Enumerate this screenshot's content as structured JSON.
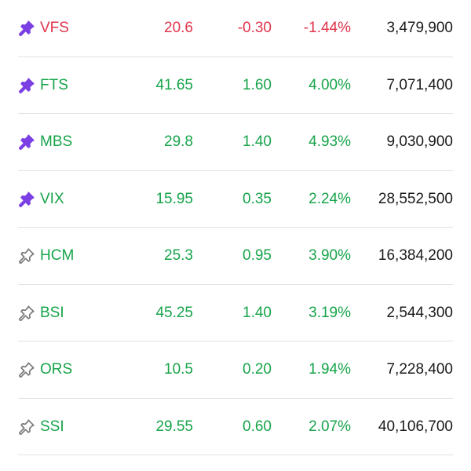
{
  "colors": {
    "up": "#17a44a",
    "down": "#e0344b",
    "pin_active": "#7b3fe4",
    "pin_inactive": "#777777"
  },
  "watchlist": [
    {
      "symbol": "VFS",
      "price": "20.6",
      "change": "-0.30",
      "pct": "-1.44%",
      "volume": "3,479,900",
      "trend": "down",
      "pinned": true
    },
    {
      "symbol": "FTS",
      "price": "41.65",
      "change": "1.60",
      "pct": "4.00%",
      "volume": "7,071,400",
      "trend": "up",
      "pinned": true
    },
    {
      "symbol": "MBS",
      "price": "29.8",
      "change": "1.40",
      "pct": "4.93%",
      "volume": "9,030,900",
      "trend": "up",
      "pinned": true
    },
    {
      "symbol": "VIX",
      "price": "15.95",
      "change": "0.35",
      "pct": "2.24%",
      "volume": "28,552,500",
      "trend": "up",
      "pinned": true
    },
    {
      "symbol": "HCM",
      "price": "25.3",
      "change": "0.95",
      "pct": "3.90%",
      "volume": "16,384,200",
      "trend": "up",
      "pinned": false
    },
    {
      "symbol": "BSI",
      "price": "45.25",
      "change": "1.40",
      "pct": "3.19%",
      "volume": "2,544,300",
      "trend": "up",
      "pinned": false
    },
    {
      "symbol": "ORS",
      "price": "10.5",
      "change": "0.20",
      "pct": "1.94%",
      "volume": "7,228,400",
      "trend": "up",
      "pinned": false
    },
    {
      "symbol": "SSI",
      "price": "29.55",
      "change": "0.60",
      "pct": "2.07%",
      "volume": "40,106,700",
      "trend": "up",
      "pinned": false
    }
  ]
}
